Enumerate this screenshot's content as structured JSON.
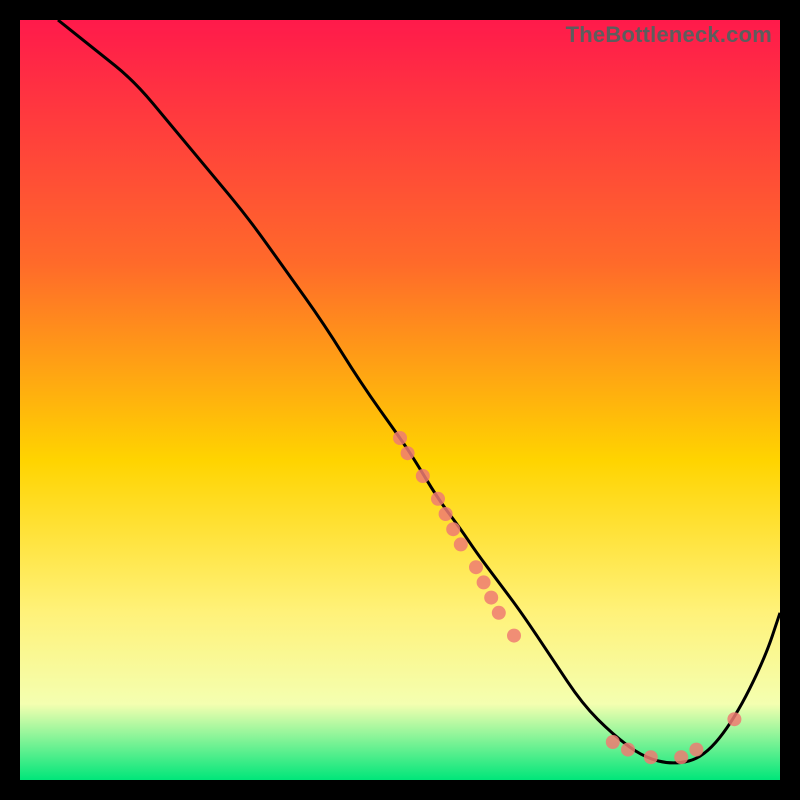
{
  "watermark": "TheBottleneck.com",
  "colors": {
    "bg": "#000000",
    "top": "#ff1a4b",
    "mid1": "#ff6a2a",
    "mid2": "#ffd400",
    "mid3": "#fff27a",
    "mid4": "#f4ffb0",
    "bottom": "#00e67a",
    "curve": "#000000",
    "marker": "#ef7b72"
  },
  "chart_data": {
    "type": "line",
    "title": "",
    "xlabel": "",
    "ylabel": "",
    "xlim": [
      0,
      100
    ],
    "ylim": [
      0,
      100
    ],
    "series": [
      {
        "name": "bottleneck-curve",
        "x": [
          5,
          10,
          15,
          20,
          25,
          30,
          35,
          40,
          45,
          50,
          52,
          55,
          58,
          60,
          63,
          66,
          70,
          74,
          78,
          82,
          86,
          90,
          94,
          98,
          100
        ],
        "y": [
          100,
          96,
          92,
          86,
          80,
          74,
          67,
          60,
          52,
          45,
          42,
          37,
          33,
          30,
          26,
          22,
          16,
          10,
          6,
          3,
          2,
          3,
          8,
          16,
          22
        ]
      }
    ],
    "markers": [
      {
        "x": 50,
        "y": 45
      },
      {
        "x": 51,
        "y": 43
      },
      {
        "x": 53,
        "y": 40
      },
      {
        "x": 55,
        "y": 37
      },
      {
        "x": 56,
        "y": 35
      },
      {
        "x": 57,
        "y": 33
      },
      {
        "x": 58,
        "y": 31
      },
      {
        "x": 60,
        "y": 28
      },
      {
        "x": 61,
        "y": 26
      },
      {
        "x": 62,
        "y": 24
      },
      {
        "x": 63,
        "y": 22
      },
      {
        "x": 65,
        "y": 19
      },
      {
        "x": 78,
        "y": 5
      },
      {
        "x": 80,
        "y": 4
      },
      {
        "x": 83,
        "y": 3
      },
      {
        "x": 87,
        "y": 3
      },
      {
        "x": 89,
        "y": 4
      },
      {
        "x": 94,
        "y": 8
      }
    ]
  }
}
